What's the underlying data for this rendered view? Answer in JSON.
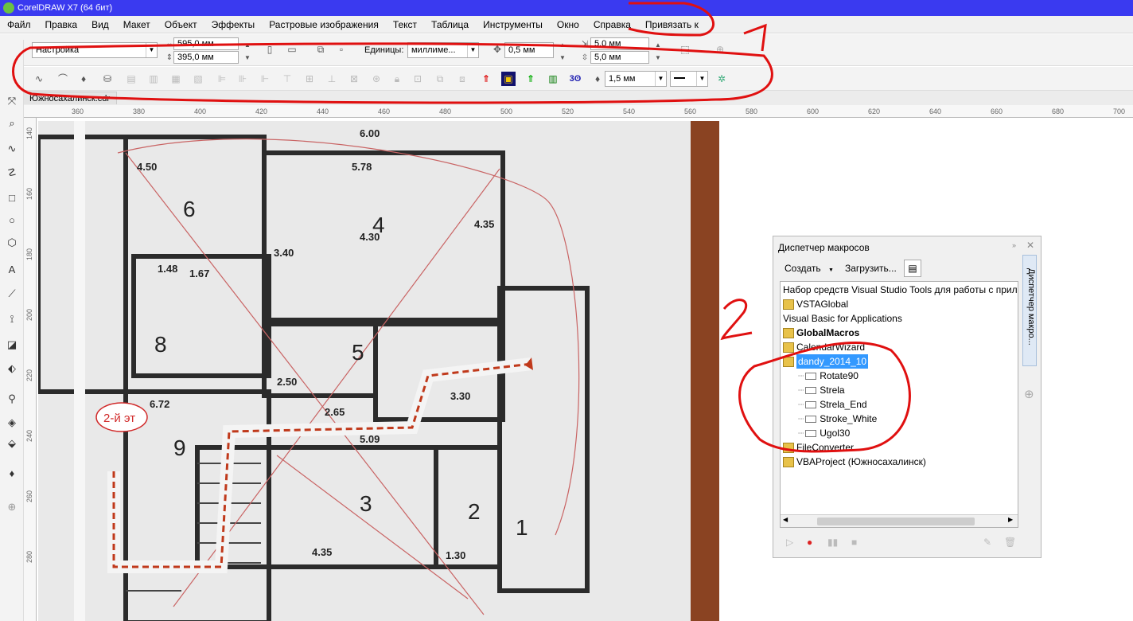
{
  "window": {
    "title": "CorelDRAW X7 (64 бит)"
  },
  "menu": [
    "Файл",
    "Правка",
    "Вид",
    "Макет",
    "Объект",
    "Эффекты",
    "Растровые изображения",
    "Текст",
    "Таблица",
    "Инструменты",
    "Окно",
    "Справка",
    "Привязать к"
  ],
  "propbar": {
    "preset": "Настройка",
    "width": "595,0 мм",
    "height": "395,0 мм",
    "units_label": "Единицы:",
    "units_value": "миллиме...",
    "nudge": "0,5 мм",
    "dup_x": "5,0 мм",
    "dup_y": "5,0 мм"
  },
  "toolbar2": {
    "outline_width": "1,5 мм",
    "arrow_icons": [
      "Strela",
      "Strela_End",
      "Stroke_White",
      "Rotate90",
      "Ugol30"
    ]
  },
  "document": {
    "tab": "Южносахалинск.cdr"
  },
  "rulers": {
    "h_ticks": [
      "360",
      "380",
      "400",
      "420",
      "440",
      "460",
      "480",
      "500",
      "520",
      "540",
      "560",
      "580",
      "600",
      "620",
      "640",
      "660",
      "680",
      "700"
    ],
    "v_ticks": [
      "140",
      "160",
      "180",
      "200",
      "220",
      "240",
      "260",
      "280"
    ]
  },
  "docker": {
    "title": "Диспетчер макросов",
    "side_tab": "Диспетчер макро...",
    "create_label": "Создать",
    "load_label": "Загрузить...",
    "tree": [
      {
        "text": "Набор средств Visual Studio Tools для работы с прило",
        "indent": 0,
        "icon": "none",
        "style": "normal"
      },
      {
        "text": "VSTAGlobal",
        "indent": 0,
        "icon": "folder",
        "style": "normal"
      },
      {
        "text": "Visual Basic for Applications",
        "indent": 0,
        "icon": "none",
        "style": "normal"
      },
      {
        "text": "GlobalMacros",
        "indent": 0,
        "icon": "folder",
        "style": "bold"
      },
      {
        "text": "CalendarWizard",
        "indent": 0,
        "icon": "folder",
        "style": "normal"
      },
      {
        "text": "dandy_2014_10",
        "indent": 0,
        "icon": "folder",
        "style": "selected"
      },
      {
        "text": "Rotate90",
        "indent": 1,
        "icon": "macro",
        "style": "normal"
      },
      {
        "text": "Strela",
        "indent": 1,
        "icon": "macro",
        "style": "normal"
      },
      {
        "text": "Strela_End",
        "indent": 1,
        "icon": "macro",
        "style": "normal"
      },
      {
        "text": "Stroke_White",
        "indent": 1,
        "icon": "macro",
        "style": "normal"
      },
      {
        "text": "Ugol30",
        "indent": 1,
        "icon": "macro",
        "style": "normal"
      },
      {
        "text": "FileConverter",
        "indent": 0,
        "icon": "folder",
        "style": "normal"
      },
      {
        "text": "VBAProject (Южносахалинск)",
        "indent": 0,
        "icon": "folder",
        "style": "normal"
      }
    ]
  },
  "floorplan": {
    "labels": [
      "6.00",
      "5.78",
      "4.50",
      "4.35",
      "3.40",
      "4.30",
      "2.50",
      "2.65",
      "5.09",
      "6.72",
      "3.30",
      "1.30",
      "4.35",
      "1.48",
      "1.67"
    ],
    "room_numbers": [
      "6",
      "4",
      "5",
      "3",
      "2",
      "1",
      "8",
      "9"
    ],
    "annotation": "2-й эт"
  },
  "annotations": {
    "one": "1",
    "two": "2"
  },
  "colors": {
    "title_bg": "#3a3af0",
    "selection": "#3399ff",
    "markup": "#e01010",
    "arrow": "#c0391b"
  }
}
